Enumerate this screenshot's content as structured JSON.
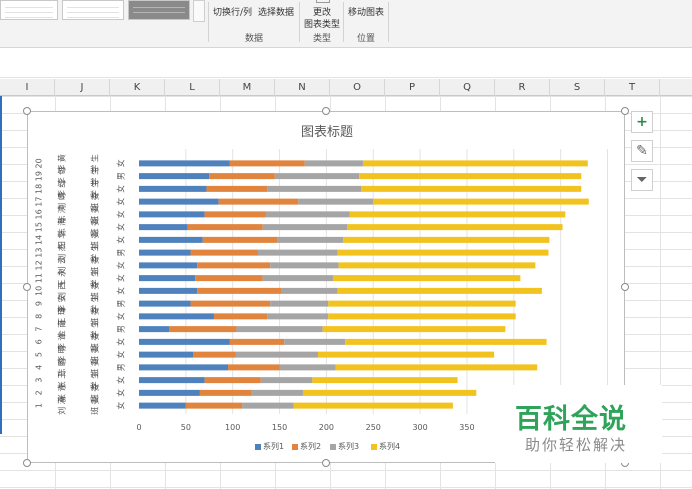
{
  "ribbon": {
    "switch_row_col": "切换行/列",
    "select_data": "选择数据",
    "group_data": "数据",
    "change_chart_type_line1": "更改",
    "change_chart_type_line2": "图表类型",
    "group_type": "类型",
    "move_chart": "移动图表",
    "group_location": "位置"
  },
  "columns": [
    "I",
    "J",
    "K",
    "L",
    "M",
    "N",
    "O",
    "P",
    "Q",
    "R",
    "S",
    "T"
  ],
  "side_buttons": {
    "add": "+",
    "style": "✎",
    "filter": "⏷"
  },
  "chart_data": {
    "type": "bar",
    "orientation": "horizontal-stacked",
    "title": "图表标题",
    "categories": [
      {
        "num": "1",
        "name": "刘 满",
        "role": "班 委",
        "sex": "女"
      },
      {
        "num": "2",
        "name": "张 许",
        "role": "班 委",
        "sex": "女"
      },
      {
        "num": "3",
        "name": "张 三",
        "role": "学 生",
        "sex": "女"
      },
      {
        "num": "4",
        "name": "陈 鹏",
        "role": "班 委",
        "sex": "男"
      },
      {
        "num": "5",
        "name": "李 明",
        "role": "班 委",
        "sex": "女"
      },
      {
        "num": "6",
        "name": "李 许",
        "role": "班 委",
        "sex": "女"
      },
      {
        "num": "7",
        "name": "金 南",
        "role": "学 生",
        "sex": "男"
      },
      {
        "num": "8",
        "name": "王 瑾",
        "role": "班 委",
        "sex": "女"
      },
      {
        "num": "9",
        "name": "李 安",
        "role": "学 生",
        "sex": "男"
      },
      {
        "num": "10",
        "name": "刘 西",
        "role": "班 委",
        "sex": "女"
      },
      {
        "num": "11",
        "name": "王 永",
        "role": "学 生",
        "sex": "女"
      },
      {
        "num": "12",
        "name": "刘 云",
        "role": "班 委",
        "sex": "女"
      },
      {
        "num": "13",
        "name": "刘 杰",
        "role": "学 生",
        "sex": "男"
      },
      {
        "num": "14",
        "name": "田 华",
        "role": "班 委",
        "sex": "女"
      },
      {
        "num": "15",
        "name": "陈 海",
        "role": "班 委",
        "sex": "女"
      },
      {
        "num": "16",
        "name": "陈 鸿",
        "role": "班 委",
        "sex": "女"
      },
      {
        "num": "17",
        "name": "刘 飒",
        "role": "班 委",
        "sex": "女"
      },
      {
        "num": "18",
        "name": "李 红",
        "role": "学 生",
        "sex": "女"
      },
      {
        "num": "19",
        "name": "李 包",
        "role": "学 生",
        "sex": "男"
      },
      {
        "num": "20",
        "name": "李 黄",
        "role": "学 生",
        "sex": "女"
      }
    ],
    "series": [
      {
        "name": "系列1",
        "color": "#4f81bd",
        "values": [
          50,
          65,
          70,
          95,
          58,
          97,
          32,
          80,
          55,
          62,
          60,
          62,
          55,
          68,
          52,
          70,
          85,
          72,
          75,
          97
        ]
      },
      {
        "name": "系列2",
        "color": "#e0843e",
        "values": [
          60,
          55,
          60,
          55,
          45,
          58,
          72,
          57,
          85,
          90,
          72,
          78,
          72,
          80,
          80,
          65,
          85,
          65,
          70,
          80
        ]
      },
      {
        "name": "系列3",
        "color": "#a5a5a5",
        "values": [
          55,
          55,
          55,
          60,
          88,
          65,
          92,
          65,
          62,
          60,
          75,
          73,
          85,
          70,
          90,
          90,
          80,
          100,
          90,
          62
        ]
      },
      {
        "name": "系列4",
        "color": "#f2c31e",
        "values": [
          170,
          185,
          155,
          215,
          188,
          215,
          195,
          200,
          200,
          218,
          200,
          210,
          225,
          220,
          230,
          230,
          230,
          235,
          237,
          240
        ]
      }
    ],
    "xlim": [
      0,
      500
    ],
    "xticks": [
      "0",
      "50",
      "100",
      "150",
      "200",
      "250",
      "300",
      "350"
    ],
    "legend_position": "bottom",
    "grid": "vertical"
  },
  "watermark": {
    "title": "百科全说",
    "subtitle": "助你轻松解决"
  }
}
